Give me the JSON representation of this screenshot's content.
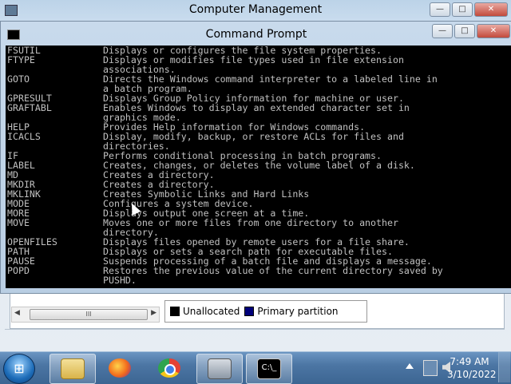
{
  "background_window": {
    "title": "Computer Management",
    "controls": {
      "minimize": "—",
      "maximize": "□",
      "close": "✕"
    },
    "legend": [
      {
        "label": "Unallocated",
        "color": "#000000"
      },
      {
        "label": "Primary partition",
        "color": "#00007a"
      }
    ],
    "scroll_thumb_label": "III"
  },
  "cmd_window": {
    "title": "Command Prompt",
    "controls": {
      "minimize": "—",
      "maximize": "□",
      "close": "✕"
    },
    "lines": [
      {
        "cmd": "FSUTIL",
        "desc": "Displays or configures the file system properties."
      },
      {
        "cmd": "FTYPE",
        "desc": "Displays or modifies file types used in file extension"
      },
      {
        "cmd": "",
        "desc": "associations."
      },
      {
        "cmd": "GOTO",
        "desc": "Directs the Windows command interpreter to a labeled line in"
      },
      {
        "cmd": "",
        "desc": "a batch program."
      },
      {
        "cmd": "GPRESULT",
        "desc": "Displays Group Policy information for machine or user."
      },
      {
        "cmd": "GRAFTABL",
        "desc": "Enables Windows to display an extended character set in"
      },
      {
        "cmd": "",
        "desc": "graphics mode."
      },
      {
        "cmd": "HELP",
        "desc": "Provides Help information for Windows commands."
      },
      {
        "cmd": "ICACLS",
        "desc": "Display, modify, backup, or restore ACLs for files and"
      },
      {
        "cmd": "",
        "desc": "directories."
      },
      {
        "cmd": "IF",
        "desc": "Performs conditional processing in batch programs."
      },
      {
        "cmd": "LABEL",
        "desc": "Creates, changes, or deletes the volume label of a disk."
      },
      {
        "cmd": "MD",
        "desc": "Creates a directory."
      },
      {
        "cmd": "MKDIR",
        "desc": "Creates a directory."
      },
      {
        "cmd": "MKLINK",
        "desc": "Creates Symbolic Links and Hard Links"
      },
      {
        "cmd": "MODE",
        "desc": "Configures a system device."
      },
      {
        "cmd": "MORE",
        "desc": "Displays output one screen at a time."
      },
      {
        "cmd": "MOVE",
        "desc": "Moves one or more files from one directory to another"
      },
      {
        "cmd": "",
        "desc": "directory."
      },
      {
        "cmd": "OPENFILES",
        "desc": "Displays files opened by remote users for a file share."
      },
      {
        "cmd": "PATH",
        "desc": "Displays or sets a search path for executable files."
      },
      {
        "cmd": "PAUSE",
        "desc": "Suspends processing of a batch file and displays a message."
      },
      {
        "cmd": "POPD",
        "desc": "Restores the previous value of the current directory saved by"
      },
      {
        "cmd": "",
        "desc": "PUSHD."
      }
    ]
  },
  "taskbar": {
    "items": [
      {
        "name": "windows-explorer-taskbar-button",
        "icon": "folder-icon",
        "cls": "explorer",
        "active": true
      },
      {
        "name": "firefox-taskbar-button",
        "icon": "firefox-icon",
        "cls": "firefox",
        "active": false
      },
      {
        "name": "chrome-taskbar-button",
        "icon": "chrome-icon",
        "cls": "chrome",
        "active": false
      },
      {
        "name": "computer-management-taskbar-button",
        "icon": "computer-management-icon",
        "cls": "network",
        "active": true
      },
      {
        "name": "command-prompt-taskbar-button",
        "icon": "command-prompt-icon",
        "cls": "cmdtb",
        "active": true
      }
    ],
    "clock_time": "7:49 AM",
    "clock_date": "3/10/2022"
  }
}
